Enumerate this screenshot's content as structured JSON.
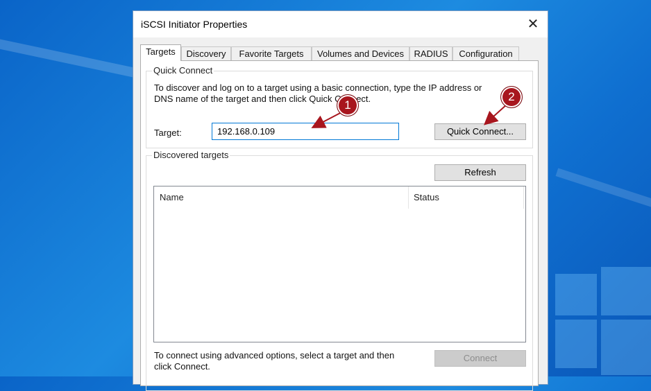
{
  "window": {
    "title": "iSCSI Initiator Properties",
    "close_glyph": "✕"
  },
  "tabs": [
    {
      "label": "Targets",
      "active": true
    },
    {
      "label": "Discovery"
    },
    {
      "label": "Favorite Targets"
    },
    {
      "label": "Volumes and Devices"
    },
    {
      "label": "RADIUS"
    },
    {
      "label": "Configuration"
    }
  ],
  "quick_connect": {
    "group_label": "Quick Connect",
    "description_line1": "To discover and log on to a target using a basic connection, type the IP address or",
    "description_line2": "DNS name of the target and then click Quick Connect.",
    "target_label": "Target:",
    "target_value": "192.168.0.109",
    "button_label": "Quick Connect..."
  },
  "discovered": {
    "group_label": "Discovered targets",
    "refresh_label": "Refresh",
    "columns": [
      "Name",
      "Status"
    ],
    "rows": []
  },
  "footer": {
    "hint_line1": "To connect using advanced options, select a target and then",
    "hint_line2": "click Connect.",
    "connect_label": "Connect"
  },
  "annotations": {
    "badge1": "1",
    "badge2": "2",
    "color": "#a8161e"
  }
}
